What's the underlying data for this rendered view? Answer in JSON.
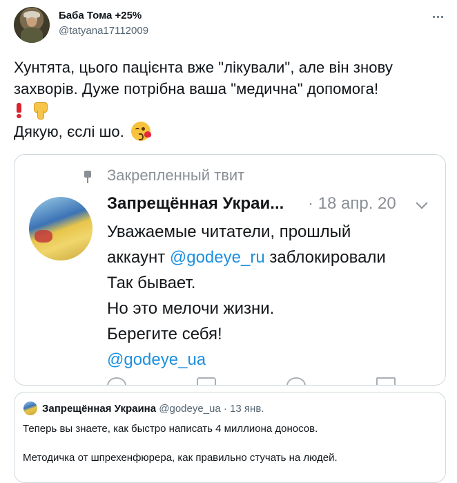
{
  "author": {
    "name": "Баба Тома +25%",
    "handle": "@tatyana17112009"
  },
  "tweet": {
    "line1": "Хунтята, цього пацієнта вже \"лікували\", але він знову",
    "line2": "захворів. Дуже потрібна ваша \"медична\" допомога!",
    "line4": "Дякую, єслі шо."
  },
  "emojis": [
    "exclamation-icon",
    "thumbs-down-icon",
    "face-blowing-kiss-icon"
  ],
  "embedded_screenshot": {
    "pinned_label": "Закрепленный твит",
    "name": "Запрещённая Украи...",
    "date": "· 18 апр. 20",
    "lines": [
      "Уважаемые читатели, прошлый",
      "заблокировали",
      "Так бывает.",
      "Но это мелочи жизни.",
      "Берегите себя!"
    ],
    "mention_1_prefix": "аккаунт ",
    "mention_1": "@godeye_ru",
    "mention_2": "@godeye_ua"
  },
  "quote": {
    "name": "Запрещённая Украина",
    "handle": "@godeye_ua",
    "separator": "·",
    "date": "13 янв.",
    "line1": "Теперь вы знаете, как быстро написать 4 миллиона доносов.",
    "line2": "Методичка от шпрехенфюрера, как правильно стучать на людей."
  },
  "colors": {
    "text": "#0f1419",
    "secondary": "#536471",
    "link": "#1d8fe0",
    "border": "#cfd9de"
  }
}
